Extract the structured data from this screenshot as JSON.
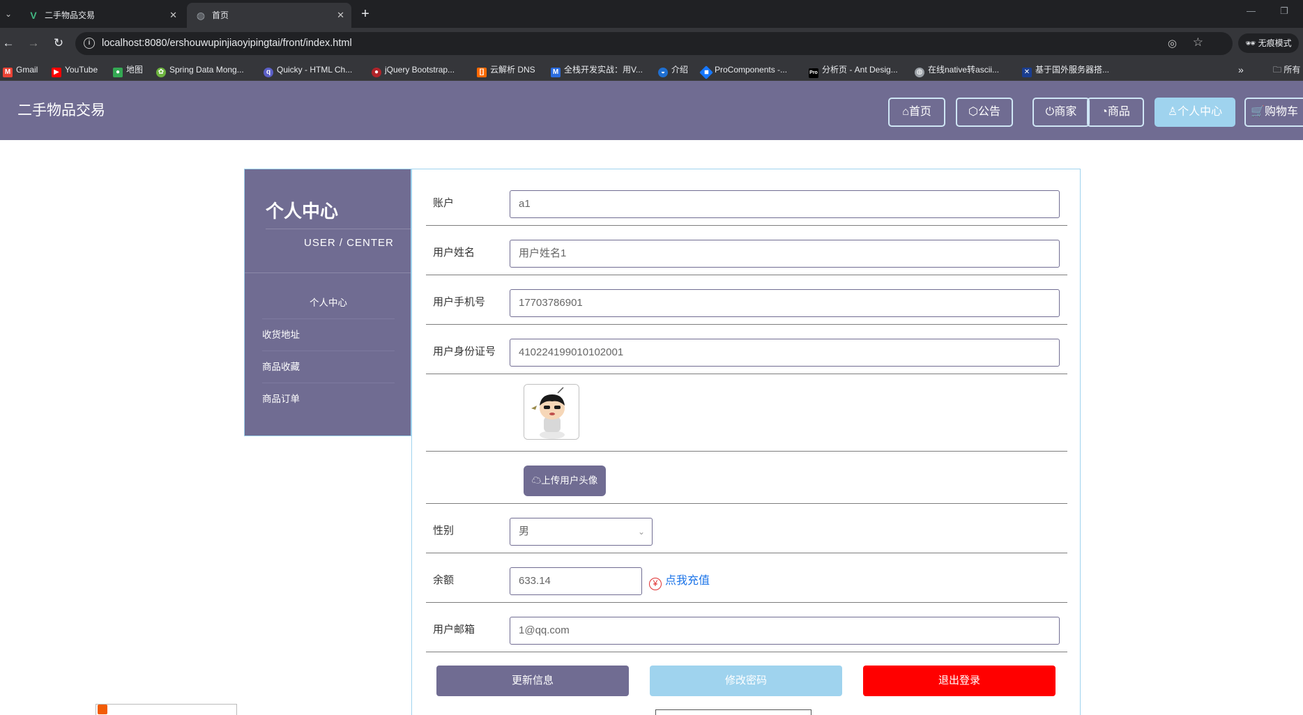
{
  "browser": {
    "tabs": [
      {
        "title": "二手物品交易",
        "active": false,
        "favicon": "vue-logo-icon"
      },
      {
        "title": "首页",
        "active": true,
        "favicon": "globe-icon"
      }
    ],
    "url": "localhost:8080/ershouwupinjiaoyipingtai/front/index.html",
    "incognito_label": "无痕模式",
    "bookmarks": [
      "Gmail",
      "YouTube",
      "地图",
      "Spring Data Mong...",
      "Quicky - HTML Ch...",
      "jQuery Bootstrap...",
      "云解析 DNS",
      "全栈开发实战：用V...",
      "介绍",
      "ProComponents -...",
      "分析页 - Ant Desig...",
      "在线native转ascii...",
      "基于国外服务器搭..."
    ],
    "bookmarks_more": "»",
    "all_bookmarks": "所有"
  },
  "header": {
    "site_title": "二手物品交易",
    "nav": [
      {
        "label": "首页",
        "icon": "home-icon",
        "active": false
      },
      {
        "label": "公告",
        "icon": "cube-icon",
        "active": false
      },
      {
        "label": "商家",
        "icon": "power-icon",
        "active": false
      },
      {
        "label": "商品",
        "icon": "gauge-icon",
        "active": false
      },
      {
        "label": "个人中心",
        "icon": "user-icon",
        "active": true
      },
      {
        "label": "购物车",
        "icon": "cart-icon",
        "active": false
      }
    ],
    "colors": {
      "primary": "#706c92",
      "active": "#9fd3ee"
    }
  },
  "sidebar": {
    "title": "个人中心",
    "subtitle": "USER / CENTER",
    "items": [
      "个人中心",
      "收货地址",
      "商品收藏",
      "商品订单"
    ]
  },
  "form": {
    "account": {
      "label": "账户",
      "value": "a1"
    },
    "name": {
      "label": "用户姓名",
      "value": "用户姓名1"
    },
    "phone": {
      "label": "用户手机号",
      "value": "17703786901"
    },
    "id_card": {
      "label": "用户身份证号",
      "value": "410224199010102001"
    },
    "upload_label": "上传用户头像",
    "gender": {
      "label": "性别",
      "value": "男"
    },
    "balance": {
      "label": "余额",
      "value": "633.14",
      "recharge_label": "点我充值",
      "recharge_icon": "¥"
    },
    "email": {
      "label": "用户邮箱",
      "value": "1@qq.com"
    }
  },
  "actions": {
    "update": {
      "label": "更新信息",
      "color": "#706c92"
    },
    "change_password": {
      "label": "修改密码",
      "color": "#9fd3ee"
    },
    "logout": {
      "label": "退出登录",
      "color": "#ff0000"
    }
  }
}
